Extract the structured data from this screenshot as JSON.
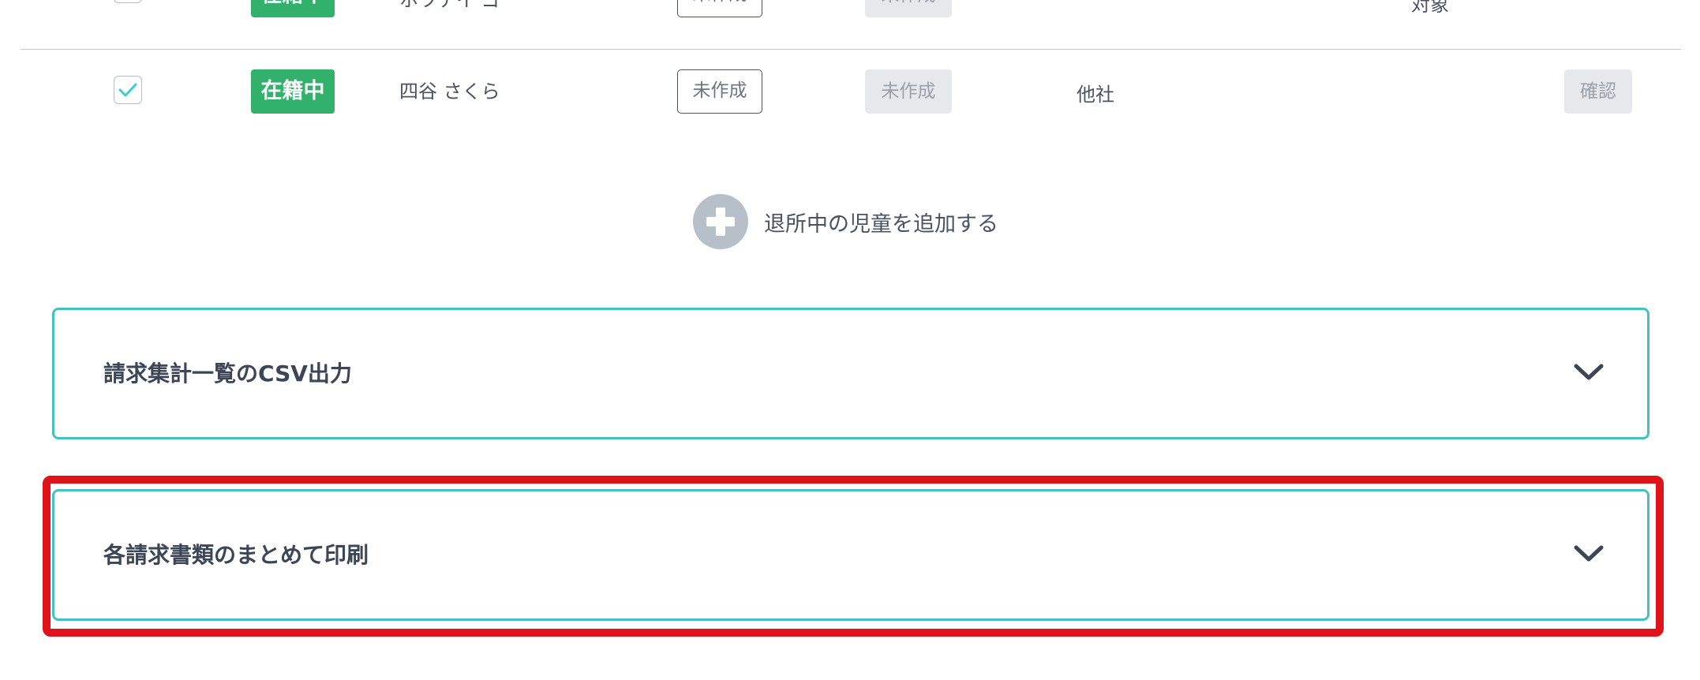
{
  "rows": [
    {
      "status": "在籍中",
      "name": "ホワテイ ゴ",
      "doc1": "未作成",
      "doc2": "未作成",
      "company": "",
      "target": "対象",
      "confirm": ""
    },
    {
      "status": "在籍中",
      "name": "四谷 さくら",
      "doc1": "未作成",
      "doc2": "未作成",
      "company": "他社",
      "target": "",
      "confirm": "確認"
    }
  ],
  "add_withdrawn_label": "退所中の児童を追加する",
  "accordions": [
    {
      "title": "請求集計一覧のCSV出力"
    },
    {
      "title": "各請求書類のまとめて印刷"
    }
  ],
  "icons": {
    "check": "check-icon",
    "plus": "plus-circle-icon",
    "chevron": "chevron-down-icon"
  },
  "colors": {
    "status_badge": "#31b16c",
    "check": "#3ccfcf",
    "accordion_border": "#45c1c3",
    "highlight": "#e0121a"
  }
}
